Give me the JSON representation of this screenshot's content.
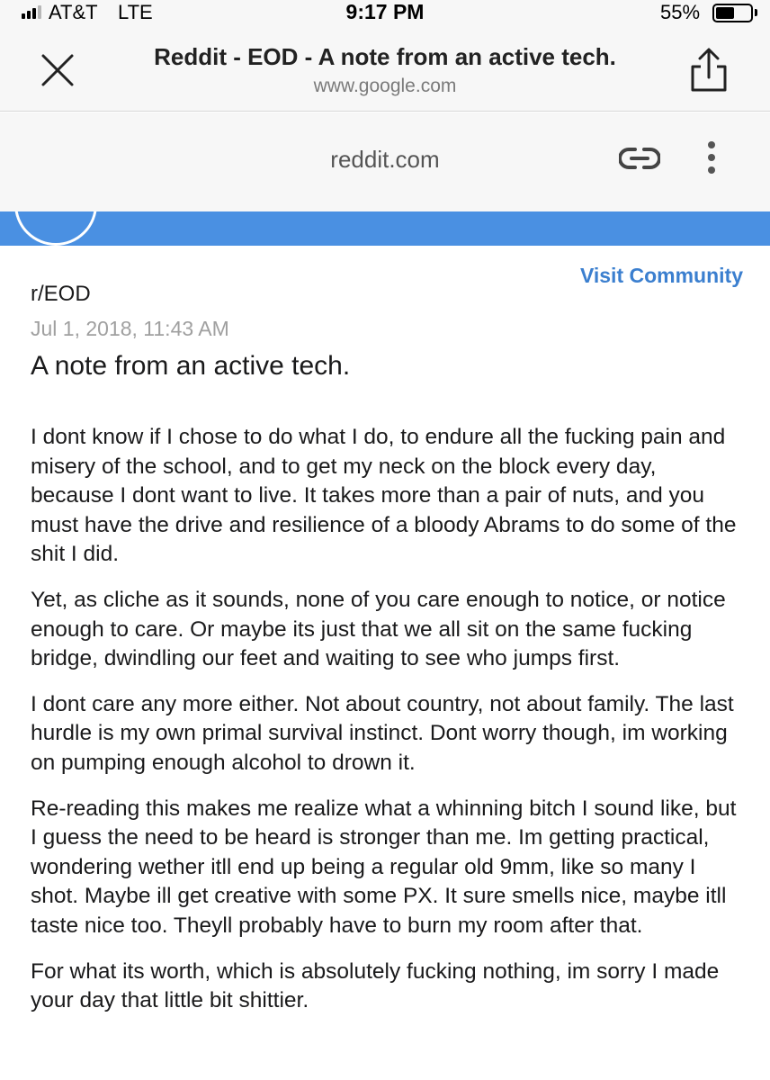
{
  "status_bar": {
    "carrier": "AT&T",
    "network": "LTE",
    "time": "9:17 PM",
    "battery_percent": "55%",
    "battery_level": 0.55,
    "signal_bars_active": 3,
    "signal_bars_total": 4
  },
  "browser": {
    "title": "Reddit - EOD - A note from an active tech.",
    "domain": "www.google.com",
    "close_icon": "close-icon",
    "share_icon": "share-icon"
  },
  "amp_bar": {
    "domain": "reddit.com",
    "link_icon": "link-icon",
    "more_icon": "more-vertical-icon"
  },
  "colors": {
    "banner": "#4a90e2",
    "link": "#3b7fcf",
    "date": "#a0a0a0"
  },
  "post": {
    "visit_community": "Visit Community",
    "subreddit": "r/EOD",
    "date": "Jul 1, 2018, 11:43 AM",
    "title": "A note from an active tech.",
    "paragraphs": [
      "I dont know if I chose to do what I do, to endure all the fucking pain and misery of the school, and to get my neck on the block every day, because I dont want to live. It takes more than a pair of nuts, and you must have the drive and resilience of a bloody Abrams to do some of the shit I did.",
      "Yet, as cliche as it sounds, none of you care enough to notice, or notice enough to care. Or maybe its just that we all sit on the same fucking bridge, dwindling our feet and waiting to see who jumps first.",
      "I dont care any more either. Not about country, not about family. The last hurdle is my own primal survival instinct. Dont worry though, im working on pumping enough alcohol to drown it.",
      "Re-reading this makes me realize what a whinning bitch I sound like, but I guess the need to be heard is stronger than me. Im getting practical, wondering wether itll end up being a regular old 9mm, like so many I shot. Maybe ill get creative with some PX. It sure smells nice, maybe itll taste nice too. Theyll probably have to burn my room after that.",
      "For what its worth, which is absolutely fucking nothing, im sorry I made your day that little bit shittier."
    ]
  }
}
